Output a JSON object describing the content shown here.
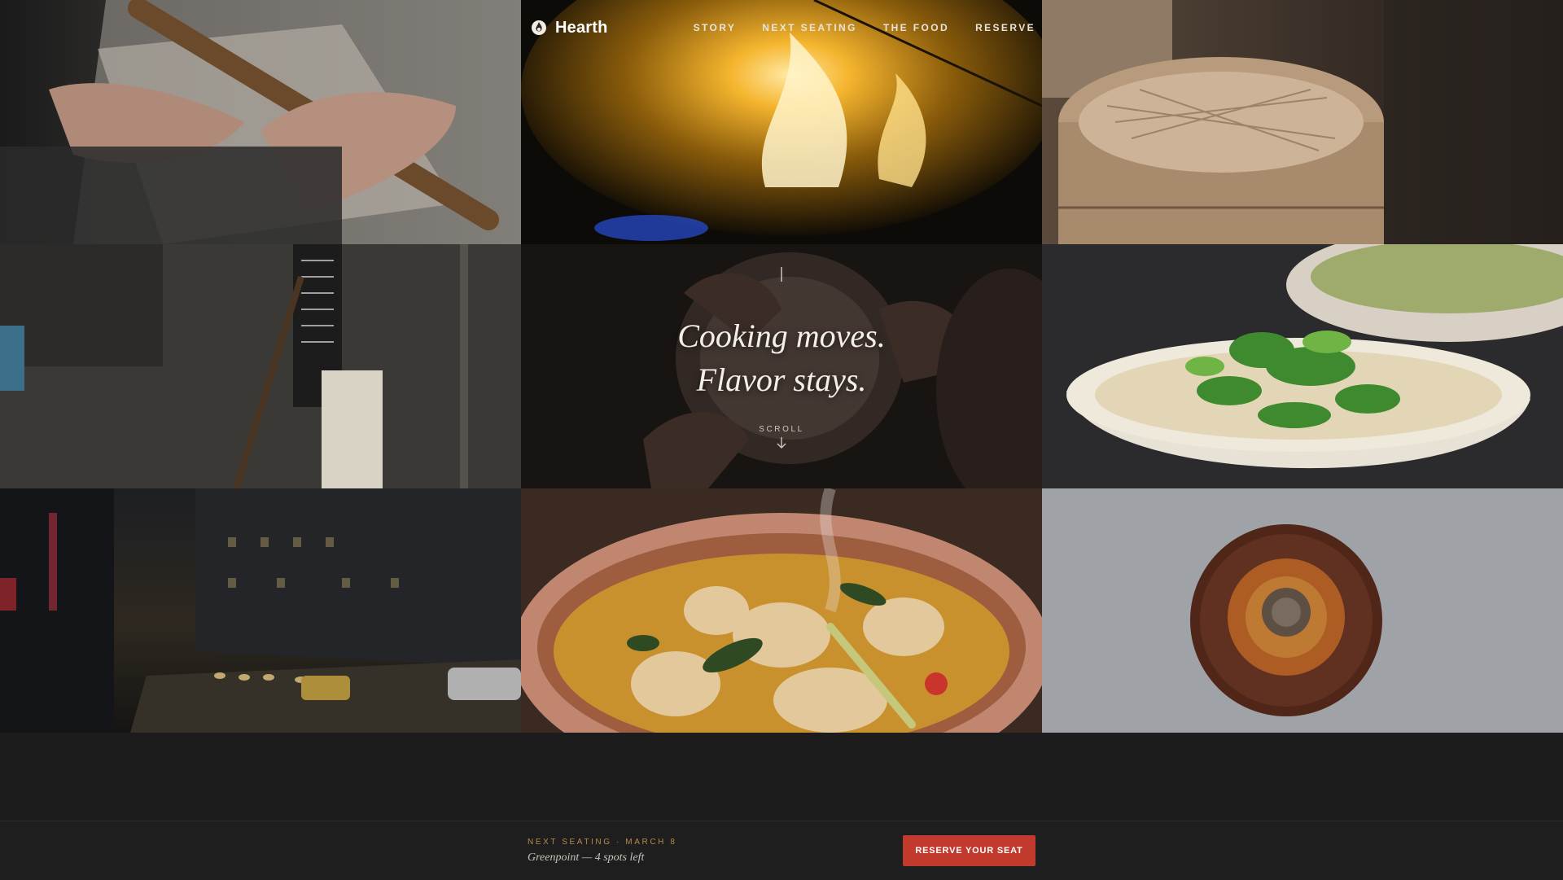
{
  "brand": {
    "name": "Hearth",
    "icon": "hearth-logo-icon"
  },
  "nav": {
    "links": [
      "STORY",
      "NEXT SEATING",
      "THE FOOD",
      "RESERVE"
    ]
  },
  "hero": {
    "line1": "Cooking moves.",
    "line2": "Flavor stays.",
    "scroll_label": "SCROLL",
    "scroll_icon": "arrow-down-icon"
  },
  "bottom_bar": {
    "seating_label": "NEXT SEATING · MARCH 8",
    "seating_detail": "Greenpoint — 4 spots left",
    "reserve_label": "RESERVE YOUR SEAT"
  },
  "colors": {
    "accent": "#c23a2d",
    "gold_label": "#b58a4f",
    "background": "#1c1c1c"
  }
}
